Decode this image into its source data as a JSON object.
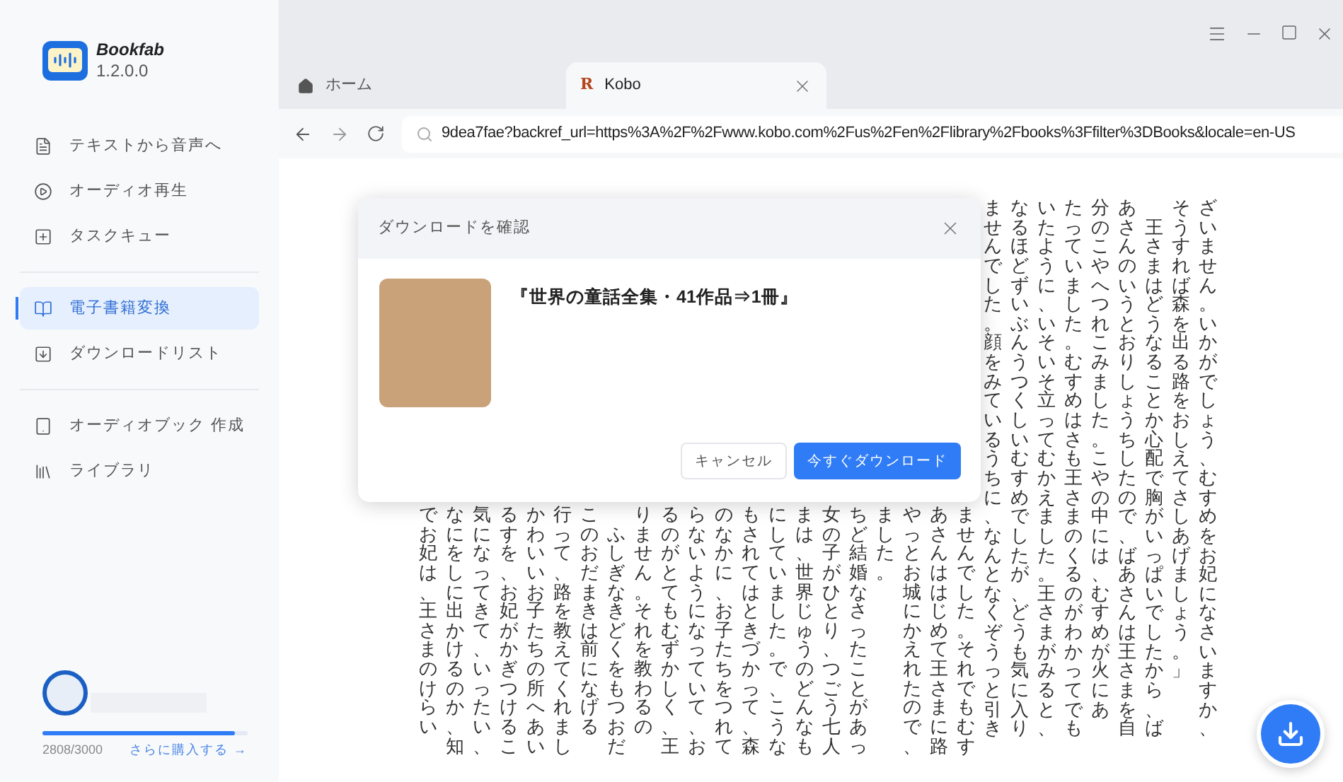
{
  "app": {
    "name": "Bookfab",
    "version": "1.2.0.0"
  },
  "sidebar": {
    "groups": [
      [
        {
          "label": "テキストから音声へ",
          "selected": false
        },
        {
          "label": "オーディオ再生",
          "selected": false
        },
        {
          "label": "タスクキュー",
          "selected": false
        }
      ],
      [
        {
          "label": "電子書籍変換",
          "selected": true
        },
        {
          "label": "ダウンロードリスト",
          "selected": false
        }
      ],
      [
        {
          "label": "オーディオブック 作成",
          "selected": false
        },
        {
          "label": "ライブラリ",
          "selected": false
        }
      ]
    ]
  },
  "account": {
    "usage": "2808/3000",
    "level": 0.936,
    "link": "さらに購入する →"
  },
  "tabs": [
    {
      "label": "ホーム",
      "selected": false,
      "closable": false
    },
    {
      "label": "Kobo",
      "selected": true,
      "closable": true,
      "badge": "R"
    }
  ],
  "address_bar": {
    "value": "9dea7fae?backref_url=https%3A%2F%2Fwww.kobo.com%2Fus%2Fen%2Flibrary%2Fbooks%3Ffilter%3DBooks&locale=en-US"
  },
  "book_page": {
    "columns": [
      {
        "kind": "partial",
        "text": "でお妃は、王さまのけらい"
      },
      {
        "kind": "partial",
        "text": "なにをしに出かけるのか、知"
      },
      {
        "kind": "partial",
        "text": "気になってきて、いったい、"
      },
      {
        "kind": "partial",
        "text": "るすを、お妃がかぎつけるこ"
      },
      {
        "kind": "partial",
        "text": "かわいいお子たちの所へあい"
      },
      {
        "kind": "partial",
        "text": "行って、路を教えてくれまし"
      },
      {
        "kind": "partial",
        "text": "このおだまきは前になげる"
      },
      {
        "kind": "partial",
        "text": "　ふしぎなきどくをもつおだ"
      },
      {
        "kind": "partial",
        "text": "りません。それを教わるの"
      },
      {
        "kind": "partial",
        "text": "るのがとてもむずかしく、王"
      },
      {
        "kind": "partial",
        "text": "らないようになっていて、お"
      },
      {
        "kind": "partial",
        "text": "のなかに、お子たちをつれて"
      },
      {
        "kind": "partial",
        "text": "もされてはときづかって、森"
      },
      {
        "kind": "partial",
        "text": "にしていました。で、こうな"
      },
      {
        "kind": "partial",
        "text": "まは、世界じゅうのどんなも"
      },
      {
        "kind": "partial",
        "text": "女の子がひとり、つごう七人"
      },
      {
        "kind": "partial",
        "text": "ちど結婚なさったことがあっ"
      },
      {
        "kind": "partial",
        "text": "ました。"
      },
      {
        "kind": "partial",
        "text": "やっとお城にかえれたので、"
      },
      {
        "kind": "partial",
        "text": "あさんははじめて王さまに路"
      },
      {
        "kind": "partial",
        "text": "ませんでした。それでもむす"
      },
      {
        "kind": "full",
        "text": "ませんでした。顔をみているうちに、なんとなくぞうっと引き"
      },
      {
        "kind": "full",
        "text": "なるほどずいぶんうつくしいむすめでしたが、どうも気に入り"
      },
      {
        "kind": "full",
        "text": "いたように、いそいそ立ってむかえました。王さまがみると、"
      },
      {
        "kind": "full",
        "text": "たっていました。むすめはさも王さまのくるのがわかってでも"
      },
      {
        "kind": "full",
        "text": "分のこやへつれこみました。こやの中には、むすめが火にあ"
      },
      {
        "kind": "full",
        "text": "あさんのいうとおりしょうちしたので、ばあさんは王さまを自"
      },
      {
        "kind": "full",
        "text": "　王さまはどうなることか心配で胸がいっぱいでしたから、ば"
      },
      {
        "kind": "full",
        "text": "そうすれば森を出る路をおしえてさしあげましょう。」"
      },
      {
        "kind": "full",
        "text": "ざいません。いかがでしょう、むすめをお妃になさいますか、"
      }
    ]
  },
  "dialog": {
    "title": "ダウンロードを確認",
    "book_title": "『世界の童話全集・41作品⇒1冊』",
    "buttons": [
      {
        "label": "キャンセル",
        "kind": "secondary"
      },
      {
        "label": "今すぐダウンロード",
        "kind": "primary"
      }
    ]
  }
}
